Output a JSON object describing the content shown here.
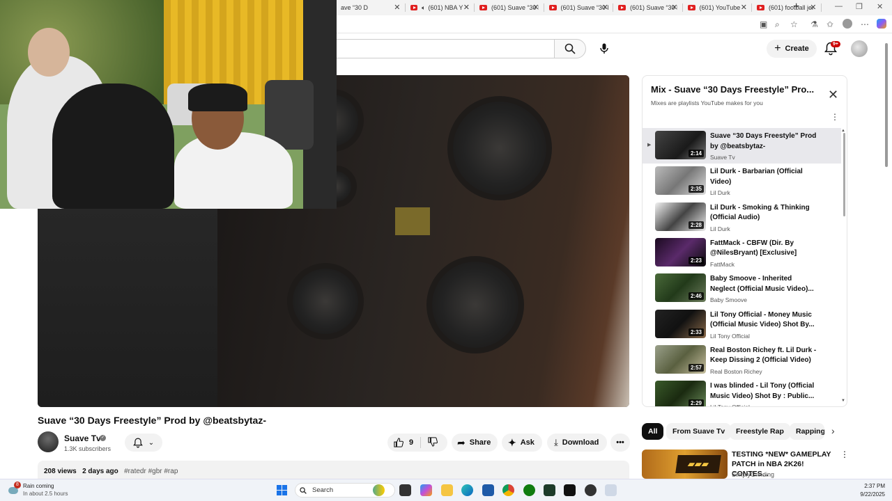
{
  "browser": {
    "tabs": [
      {
        "title": "ave “30 D",
        "audio": false
      },
      {
        "title": "(601) NBA Y",
        "audio": true
      },
      {
        "title": "(601) Suave “30 D",
        "audio": false
      },
      {
        "title": "(601) Suave “30 D",
        "audio": false
      },
      {
        "title": "(601) Suave “30 D",
        "audio": false
      },
      {
        "title": "(601) YouTube",
        "audio": false
      },
      {
        "title": "(601) football jer",
        "audio": false
      }
    ],
    "new_tab": "+",
    "window_controls": [
      "—",
      "❐",
      "✕"
    ]
  },
  "header": {
    "create_label": "Create",
    "notif_count": "9+"
  },
  "video": {
    "title": "Suave “30 Days Freestyle” Prod by @beatsbytaz-",
    "channel": "Suave Tv",
    "subscribers": "1.3K subscribers",
    "likes": "9",
    "share_label": "Share",
    "ask_label": "Ask",
    "download_label": "Download",
    "views": "208 views",
    "age": "2 days ago",
    "tags": "#ratedr #gbr #rap"
  },
  "playlist": {
    "title": "Mix - Suave “30 Days Freestyle” Pro...",
    "subtitle": "Mixes are playlists YouTube makes for you",
    "items": [
      {
        "title": "Suave “30 Days Freestyle” Prod by @beatsbytaz-",
        "channel": "Suave Tv",
        "duration": "2:14",
        "active": true
      },
      {
        "title": "Lil Durk - Barbarian (Official Video)",
        "channel": "Lil Durk",
        "duration": "2:35",
        "active": false
      },
      {
        "title": "Lil Durk - Smoking & Thinking (Official Audio)",
        "channel": "Lil Durk",
        "duration": "2:28",
        "active": false
      },
      {
        "title": "FattMack - CBFW (Dir. By @NilesBryant) [Exclusive]",
        "channel": "FattMack",
        "duration": "2:23",
        "active": false
      },
      {
        "title": "Baby Smoove - Inherited Neglect (Official Music Video)...",
        "channel": "Baby Smoove",
        "duration": "2:46",
        "active": false
      },
      {
        "title": "Lil Tony Official - Money Music (Official Music Video) Shot By...",
        "channel": "Lil Tony Official",
        "duration": "2:33",
        "active": false
      },
      {
        "title": "Real Boston Richey ft. Lil Durk - Keep Dissing 2 (Official Video)",
        "channel": "Real Boston Richey",
        "duration": "2:57",
        "active": false
      },
      {
        "title": "I was blinded - Lil Tony (Official Music Video) Shot By : Public...",
        "channel": "Lil Tony Official",
        "duration": "2:29",
        "active": false
      }
    ]
  },
  "chips": [
    "All",
    "From Suave Tv",
    "Freestyle Rap",
    "Rapping"
  ],
  "recommendation": {
    "title": "TESTING *NEW* GAMEPLAY PATCH in NBA 2K26! CONTES...",
    "channel": "SimplyGrinding"
  },
  "taskbar": {
    "weather_title": "Rain coming",
    "weather_sub": "In about 2.5 hours",
    "weather_badge": "8",
    "search_placeholder": "Search",
    "time": "2:37 PM",
    "date": "9/22/2025"
  },
  "colors": {
    "yt_red": "#e02020",
    "chip_active": "#0f0f0f",
    "badge_red": "#cc0000"
  }
}
